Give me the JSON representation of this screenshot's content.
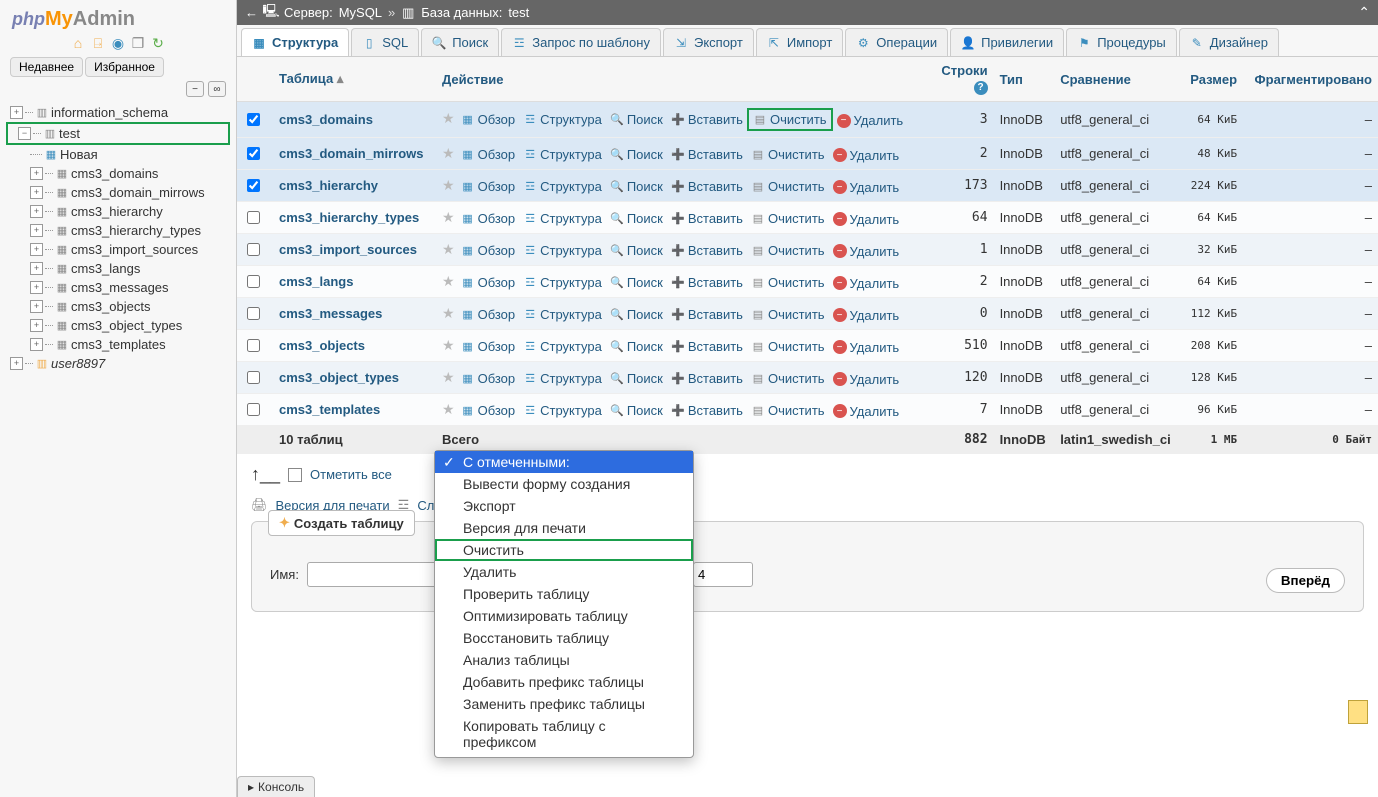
{
  "logo": {
    "php": "php",
    "my": "My",
    "admin": "Admin"
  },
  "side_tabs": {
    "recent": "Недавнее",
    "favorites": "Избранное"
  },
  "tree": {
    "db1": "information_schema",
    "db2": "test",
    "new": "Новая",
    "tables": [
      "cms3_domains",
      "cms3_domain_mirrows",
      "cms3_hierarchy",
      "cms3_hierarchy_types",
      "cms3_import_sources",
      "cms3_langs",
      "cms3_messages",
      "cms3_objects",
      "cms3_object_types",
      "cms3_templates"
    ],
    "user": "user8897"
  },
  "crumb": {
    "server_lbl": "Сервер:",
    "server": "MySQL",
    "db_lbl": "База данных:",
    "db": "test"
  },
  "tabs": [
    "Структура",
    "SQL",
    "Поиск",
    "Запрос по шаблону",
    "Экспорт",
    "Импорт",
    "Операции",
    "Привилегии",
    "Процедуры",
    "Дизайнер"
  ],
  "th": {
    "table": "Таблица",
    "action": "Действие",
    "rows": "Строки",
    "type": "Тип",
    "collation": "Сравнение",
    "size": "Размер",
    "overhead": "Фрагментировано"
  },
  "actions": {
    "browse": "Обзор",
    "structure": "Структура",
    "search": "Поиск",
    "insert": "Вставить",
    "empty": "Очистить",
    "drop": "Удалить"
  },
  "rows": [
    {
      "name": "cms3_domains",
      "rows": "3",
      "type": "InnoDB",
      "coll": "utf8_general_ci",
      "size": "64 КиБ",
      "frag": "–",
      "sel": true,
      "hl_empty": true
    },
    {
      "name": "cms3_domain_mirrows",
      "rows": "2",
      "type": "InnoDB",
      "coll": "utf8_general_ci",
      "size": "48 КиБ",
      "frag": "–",
      "sel": true
    },
    {
      "name": "cms3_hierarchy",
      "rows": "173",
      "type": "InnoDB",
      "coll": "utf8_general_ci",
      "size": "224 КиБ",
      "frag": "–",
      "sel": true
    },
    {
      "name": "cms3_hierarchy_types",
      "rows": "64",
      "type": "InnoDB",
      "coll": "utf8_general_ci",
      "size": "64 КиБ",
      "frag": "–",
      "sel": false
    },
    {
      "name": "cms3_import_sources",
      "rows": "1",
      "type": "InnoDB",
      "coll": "utf8_general_ci",
      "size": "32 КиБ",
      "frag": "–",
      "sel": false
    },
    {
      "name": "cms3_langs",
      "rows": "2",
      "type": "InnoDB",
      "coll": "utf8_general_ci",
      "size": "64 КиБ",
      "frag": "–",
      "sel": false
    },
    {
      "name": "cms3_messages",
      "rows": "0",
      "type": "InnoDB",
      "coll": "utf8_general_ci",
      "size": "112 КиБ",
      "frag": "–",
      "sel": false
    },
    {
      "name": "cms3_objects",
      "rows": "510",
      "type": "InnoDB",
      "coll": "utf8_general_ci",
      "size": "208 КиБ",
      "frag": "–",
      "sel": false
    },
    {
      "name": "cms3_object_types",
      "rows": "120",
      "type": "InnoDB",
      "coll": "utf8_general_ci",
      "size": "128 КиБ",
      "frag": "–",
      "sel": false
    },
    {
      "name": "cms3_templates",
      "rows": "7",
      "type": "InnoDB",
      "coll": "utf8_general_ci",
      "size": "96 КиБ",
      "frag": "–",
      "sel": false
    }
  ],
  "total": {
    "count": "10 таблиц",
    "label": "Всего",
    "rows": "882",
    "type": "InnoDB",
    "coll": "latin1_swedish_ci",
    "size": "1 МБ",
    "overhead": "0 Байт"
  },
  "checkall": "Отметить все",
  "print": "Версия для печати",
  "dict": "Сло",
  "create": {
    "legend": "Создать таблицу",
    "name": "Имя:",
    "cols_value": "4",
    "go": "Вперёд"
  },
  "dropdown": [
    "С отмеченными:",
    "Вывести форму создания",
    "Экспорт",
    "Версия для печати",
    "Очистить",
    "Удалить",
    "Проверить таблицу",
    "Оптимизировать таблицу",
    "Восстановить таблицу",
    "Анализ таблицы",
    "Добавить префикс таблицы",
    "Заменить префикс таблицы",
    "Копировать таблицу с префиксом"
  ],
  "console": "Консоль"
}
